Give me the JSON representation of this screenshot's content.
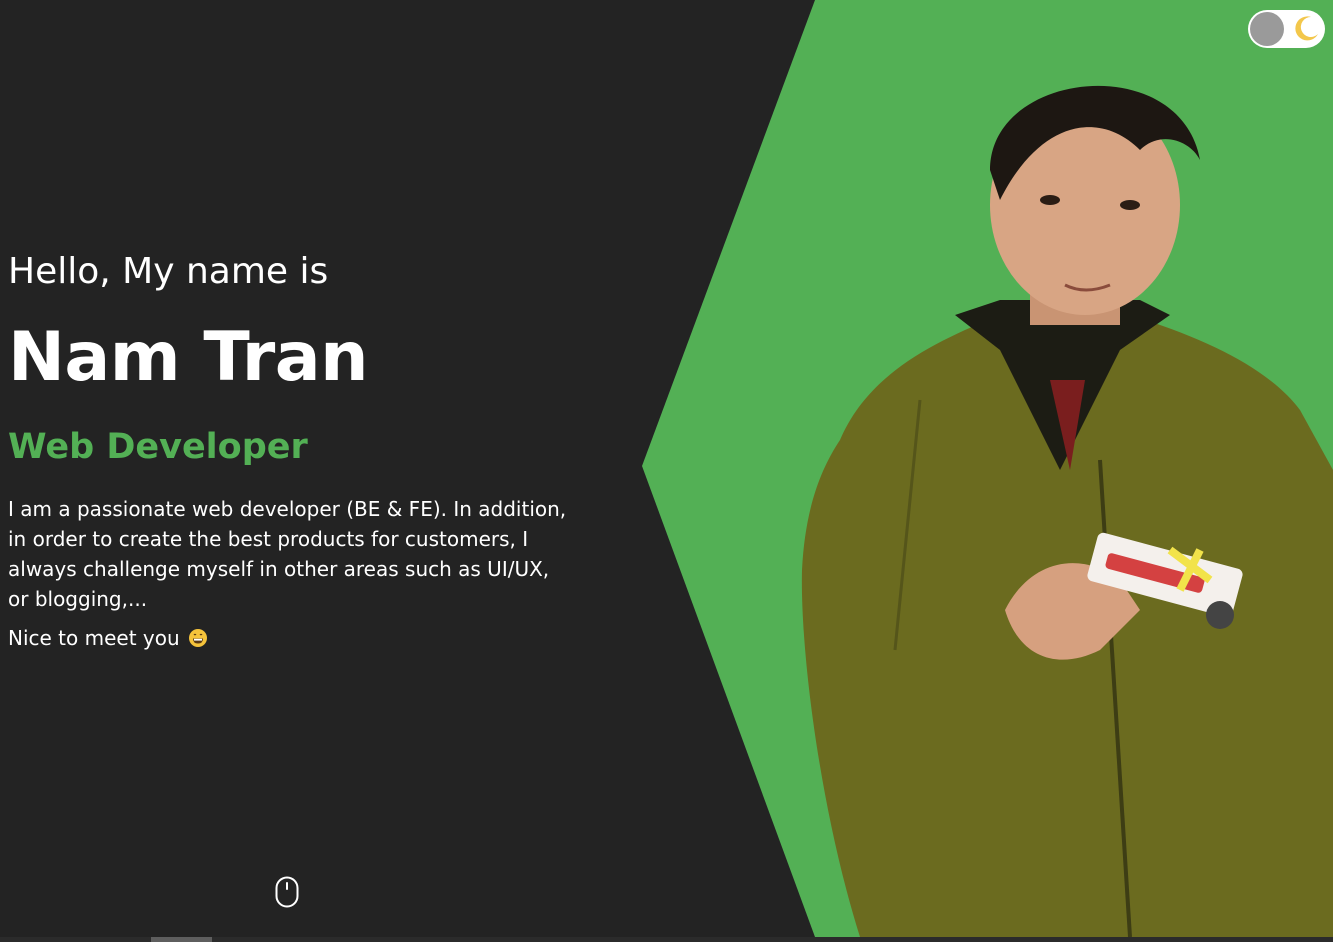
{
  "hero": {
    "greeting": "Hello, My name is",
    "name": "Nam Tran",
    "role": "Web Developer",
    "bio": "I am a passionate web developer (BE & FE). In addition, in order to create the best products for customers, I always challenge myself in other areas such as UI/UX, or blogging,...",
    "closing": "Nice to meet you"
  },
  "icons": {
    "closing_emoji": "grinning-face-icon",
    "theme_toggle": "moon-icon",
    "scroll_hint": "mouse-icon"
  },
  "colors": {
    "background": "#232323",
    "accent": "#53b055",
    "text": "#ffffff",
    "jacket": "#6b6b1f"
  }
}
